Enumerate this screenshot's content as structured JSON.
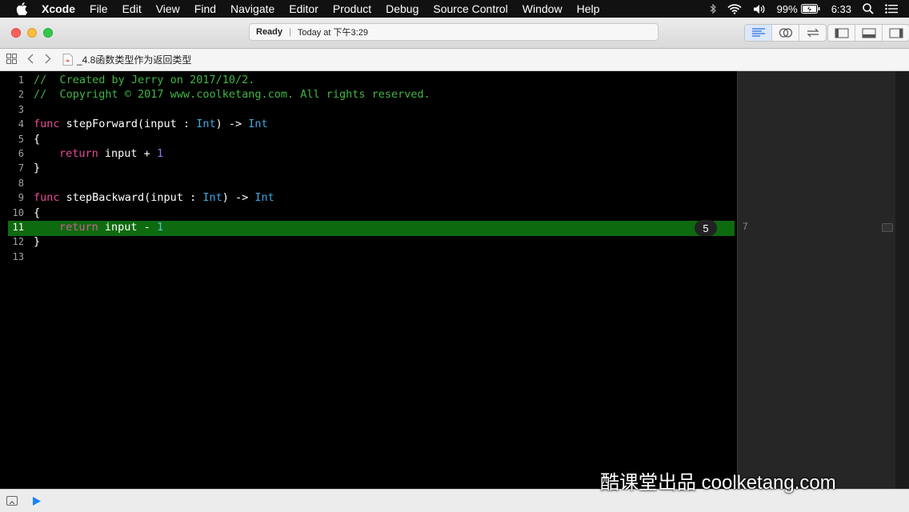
{
  "menubar": {
    "app": "Xcode",
    "items": [
      "File",
      "Edit",
      "View",
      "Find",
      "Navigate",
      "Editor",
      "Product",
      "Debug",
      "Source Control",
      "Window",
      "Help"
    ],
    "battery": "99%",
    "clock": "6:33"
  },
  "toolbar": {
    "status": "Ready",
    "timestamp": "Today at 下午3:29"
  },
  "jumpbar": {
    "file": "_4.8函数类型作为返回类型"
  },
  "editor": {
    "line_numbers": [
      "1",
      "2",
      "3",
      "4",
      "5",
      "6",
      "7",
      "8",
      "9",
      "10",
      "11",
      "12",
      "13"
    ],
    "current_line": "11",
    "lines": {
      "l1": "//  Created by Jerry on 2017/10/2.",
      "l2": "//  Copyright © 2017 www.coolketang.com. All rights reserved.",
      "l4_kw": "func",
      "l4_a": " stepForward(input : ",
      "l4_t1": "Int",
      "l4_b": ") -> ",
      "l4_t2": "Int",
      "l5": "{",
      "l6_kw": "return",
      "l6_a": " input + ",
      "l6_n": "1",
      "l7": "}",
      "l9_kw": "func",
      "l9_a": " stepBackward(input : ",
      "l9_t1": "Int",
      "l9_b": ") -> ",
      "l9_t2": "Int",
      "l10": "{",
      "l11_kw": "return",
      "l11_a": " input - ",
      "l11_n": "1",
      "l12": "}"
    },
    "inline_result": "5"
  },
  "results_sidebar": {
    "line11_value": "7"
  },
  "watermark": "酷课堂出品 coolketang.com",
  "colors": {
    "comment": "#41b645",
    "keyword": "#e94b9a",
    "type": "#3fa7e0",
    "number": "#8a7cf5",
    "highlight": "#0e6a0e"
  }
}
